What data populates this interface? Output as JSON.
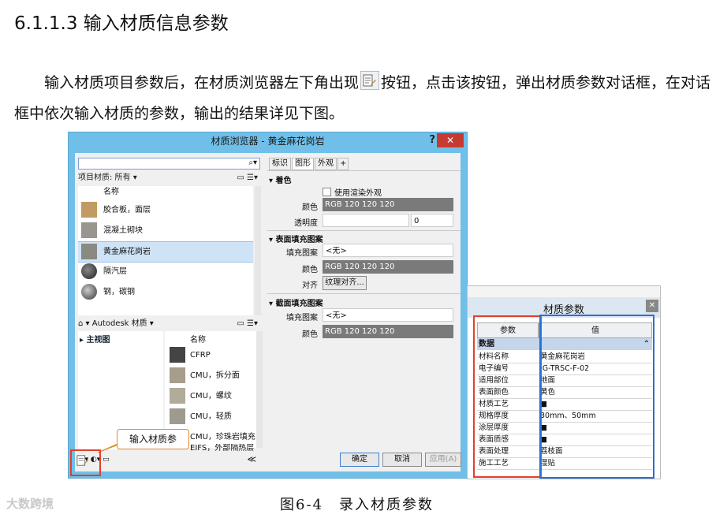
{
  "heading": "6.1.1.3 输入材质信息参数",
  "paragraph": {
    "before_icon": "输入材质项目参数后，在材质浏览器左下角出现",
    "after_icon": "按钮，点击该按钮，弹出材质参数对话框，在对话框中依次输入材质的参数，输出的结果详见下图。"
  },
  "browser": {
    "title": "材质浏览器 - 黄金麻花岗岩",
    "help": "?",
    "close": "✕",
    "filter": "项目材质: 所有 ▾",
    "list_header": "名称",
    "materials": [
      "胶合板，面层",
      "混凝土砌块",
      "黄金麻花岗岩",
      "隔汽层",
      "钢，碳钢"
    ],
    "library_bar": "Autodesk 材质 ▾",
    "tree_root": "▸ 主视图",
    "library_header": "名称",
    "library_items": [
      "CFRP",
      "CMU，拆分面",
      "CMU，螺纹",
      "CMU，轻质",
      "CMU，珍珠岩填充",
      "EIFS，外部隔热层"
    ],
    "collapse": "≪",
    "tabs": [
      "标识",
      "图形",
      "外观",
      "+"
    ],
    "section_shading": "▾ 着色",
    "use_render": "使用渲染外观",
    "color_label": "颜色",
    "color_value": "RGB 120 120 120",
    "transparency_label": "透明度",
    "transparency_value": "0",
    "section_surface": "▾ 表面填充图案",
    "fill_label": "填充图案",
    "fill_value": "<无>",
    "align_label": "对齐",
    "align_button": "纹理对齐...",
    "section_cut": "▾ 截面填充图案",
    "ok": "确定",
    "cancel": "取消",
    "apply": "应用(A)"
  },
  "callout": "输入材质参",
  "params": {
    "title": "材质参数",
    "close": "✕",
    "col_param": "参数",
    "col_value": "值",
    "group": "数据",
    "rows": [
      {
        "k": "材料名称",
        "v": "黄金麻花岗岩"
      },
      {
        "k": "电子编号",
        "v": "JG-TRSC-F-02"
      },
      {
        "k": "适用部位",
        "v": "地面"
      },
      {
        "k": "表面颜色",
        "v": "黄色"
      },
      {
        "k": "材质工艺",
        "v": "■"
      },
      {
        "k": "规格厚度",
        "v": "30mm、50mm"
      },
      {
        "k": "涂层厚度",
        "v": "■"
      },
      {
        "k": "表面质感",
        "v": "■"
      },
      {
        "k": "表面处理",
        "v": "荔枝面"
      },
      {
        "k": "施工工艺",
        "v": "湿贴"
      }
    ]
  },
  "caption": "图6-4　录入材质参数",
  "watermark": "大数跨境"
}
